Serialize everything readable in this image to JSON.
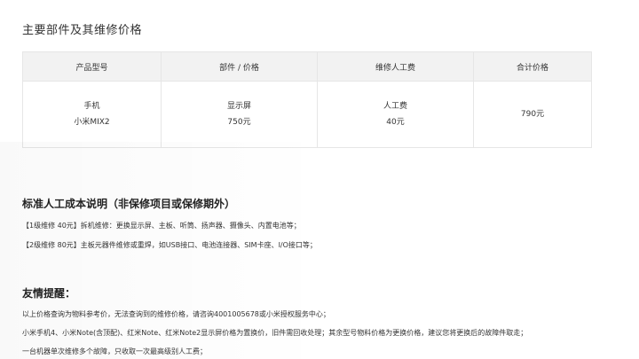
{
  "page_title": "主要部件及其维修价格",
  "table": {
    "headers": [
      "产品型号",
      "部件 / 价格",
      "维修人工费",
      "合计价格"
    ],
    "row": {
      "product_line1": "手机",
      "product_line2": "小米MIX2",
      "part_line1": "显示屏",
      "part_line2": "750元",
      "labor_line1": "人工费",
      "labor_line2": "40元",
      "total": "790元"
    }
  },
  "labor_section": {
    "title": "标准人工成本说明（非保修项目或保修期外）",
    "items": [
      "【1级维修 40元】拆机维修：更换显示屏、主板、听筒、扬声器、摄像头、内置电池等；",
      "【2级维修 80元】主板元器件维修或重焊，如USB接口、电池连接器、SIM卡座、I/O接口等；"
    ]
  },
  "notice_section": {
    "title": "友情提醒：",
    "items": [
      "以上价格查询为物料参考价，无法查询到的维修价格，请咨询4001005678或小米授权服务中心；",
      "小米手机4、小米Note(含顶配)、红米Note、红米Note2显示屏价格为置换价，旧件需回收处理；其余型号物料价格为更换价格，建议您将更换后的故障件取走；",
      "一台机器单次维修多个故障，只收取一次最高级别人工费；"
    ]
  }
}
